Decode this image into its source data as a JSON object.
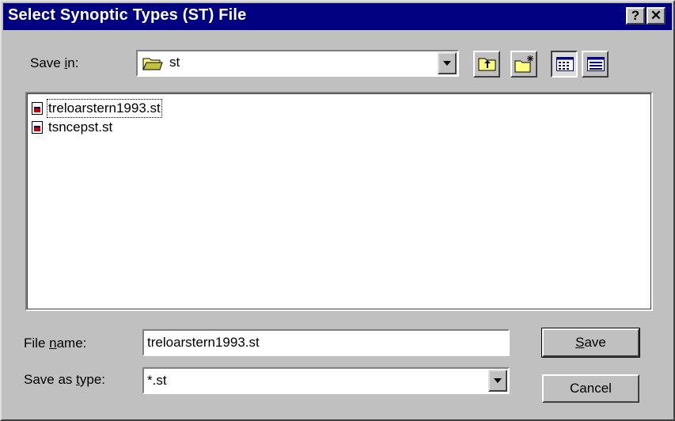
{
  "window": {
    "title": "Select Synoptic Types (ST) File",
    "help_label": "?",
    "close_label": "✕"
  },
  "save_in": {
    "label_prefix": "Save ",
    "label_accel": "i",
    "label_suffix": "n:",
    "folder": "st"
  },
  "files": [
    {
      "name": "treloarstern1993.st"
    },
    {
      "name": "tsncepst.st"
    }
  ],
  "file_name": {
    "label_prefix": "File ",
    "label_accel": "n",
    "label_suffix": "ame:",
    "value": "treloarstern1993.st"
  },
  "save_as_type": {
    "label_prefix": "Save as ",
    "label_accel": "t",
    "label_suffix": "ype:",
    "value": "*.st"
  },
  "buttons": {
    "save_accel": "S",
    "save_rest": "ave",
    "cancel": "Cancel"
  },
  "icons": {
    "folder": "folder-icon",
    "up_folder": "up-folder-icon",
    "new_folder": "new-folder-icon",
    "list_view": "list-view-icon",
    "details_view": "details-view-icon",
    "file": "st-file-icon"
  }
}
